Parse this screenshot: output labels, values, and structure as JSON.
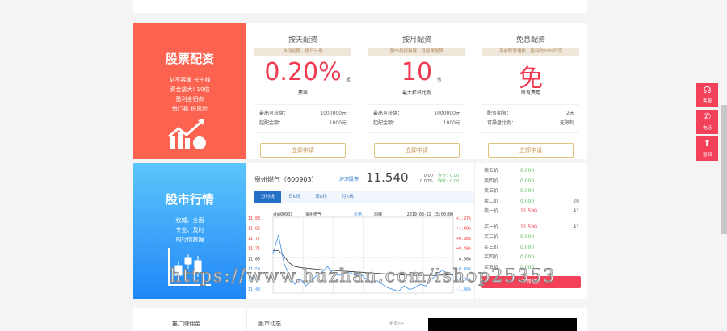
{
  "peizi": {
    "title": "股票配资",
    "lines": [
      "刻不容缓 长出线",
      "资金放大! 10倍",
      "盈利全归你",
      "借门槛 低风险"
    ],
    "plans": [
      {
        "title": "按天配资",
        "tag": "自动延期，按日计息",
        "big": "0.20%",
        "unit": "起",
        "label": "费率",
        "rows": [
          [
            "最高可获盘：",
            "1000000元"
          ],
          [
            "起配金额：",
            "1000元"
          ]
        ],
        "button": "立即申请"
      },
      {
        "title": "按月配资",
        "tag": "股市投资利器，月配更划算",
        "big": "10",
        "unit": "倍",
        "label": "最大杠杆比例",
        "rows": [
          [
            "最高可获盘：",
            "1000000元"
          ],
          [
            "起配金额：",
            "1000元"
          ]
        ],
        "button": "立即申请"
      },
      {
        "title": "免息配资",
        "tag": "不收取管理费，盈利的70%归您",
        "big": "免",
        "unit": "",
        "label": "所有费用",
        "rows": [
          [
            "配资期限：",
            "2天"
          ],
          [
            "可操盘比例：",
            "无限制"
          ]
        ],
        "button": "立即申请"
      }
    ]
  },
  "market": {
    "title": "股市行情",
    "lines": [
      "权威、全面",
      "专业、及时",
      "的行情数据"
    ],
    "stock_name": "贵州燃气（600903）",
    "tag": "沪深股市",
    "price": "11.540",
    "change": "0.00",
    "change_pct": "0.00%",
    "open_label": "今开：0.00",
    "close_label": "昨收：0.00",
    "tabs": [
      "分时线",
      "日K线",
      "周K线",
      "月K线"
    ],
    "quote": [
      [
        "卖五价",
        "0.000",
        ""
      ],
      [
        "卖四价",
        "0.000",
        ""
      ],
      [
        "卖三价",
        "0.000",
        ""
      ],
      [
        "卖二价",
        "0.000",
        "20"
      ],
      [
        "卖一价",
        "11.580",
        "41"
      ],
      [
        "买一价",
        "11.580",
        "41"
      ],
      [
        "买二价",
        "0.000",
        ""
      ],
      [
        "买三价",
        "0.000",
        ""
      ],
      [
        "买四价",
        "0.000",
        ""
      ],
      [
        "买五价",
        "0.000",
        ""
      ]
    ],
    "quote_button": "立即配资"
  },
  "chart_data": {
    "type": "line",
    "code": "sh600903",
    "name": "贵州燃气",
    "legend": [
      "价格",
      "均线"
    ],
    "datetime": "2019-08-22 15:00:00",
    "yticks": [
      "11.88",
      "11.82",
      "11.77",
      "11.71",
      "11.65",
      "11.59",
      "11.54",
      "11.48"
    ],
    "pct_ticks": [
      "+1.97%",
      "+1.48%",
      "+0.98%",
      "+0.49%",
      "0.00%",
      "-0.49%",
      "-0.98%",
      "-1.48%"
    ],
    "ylim": [
      11.45,
      11.88
    ],
    "prev_close": 11.65,
    "price": [
      11.67,
      11.78,
      11.62,
      11.55,
      11.5,
      11.53,
      11.49,
      11.52,
      11.55,
      11.57,
      11.6,
      11.56,
      11.55,
      11.56,
      11.57,
      11.55,
      11.56,
      11.53,
      11.51,
      11.52,
      11.5,
      11.48,
      11.47,
      11.46,
      11.49,
      11.47,
      11.48,
      11.5,
      11.49,
      11.53,
      11.55,
      11.58,
      11.56,
      11.55
    ],
    "avg": [
      11.69,
      11.69,
      11.66,
      11.62,
      11.6,
      11.595,
      11.59,
      11.588,
      11.585,
      11.582,
      11.58,
      11.578,
      11.576,
      11.574,
      11.572,
      11.57,
      11.568,
      11.566,
      11.564,
      11.562,
      11.56,
      11.558,
      11.556,
      11.554,
      11.552,
      11.551,
      11.55,
      11.55,
      11.55,
      11.55,
      11.55,
      11.552,
      11.553,
      11.553
    ],
    "colors": {
      "price": "#3a8ee6",
      "avg": "#333333"
    }
  },
  "side": [
    {
      "icon": "headset",
      "label": "客服"
    },
    {
      "icon": "phone",
      "label": "电话"
    },
    {
      "icon": "arrow-up",
      "label": "返回"
    }
  ],
  "bottom": {
    "commission": "推广赚佣金",
    "news": "股市动态",
    "more": "更多>>"
  },
  "watermark": "https://www.huzhan.com/ishop25353"
}
